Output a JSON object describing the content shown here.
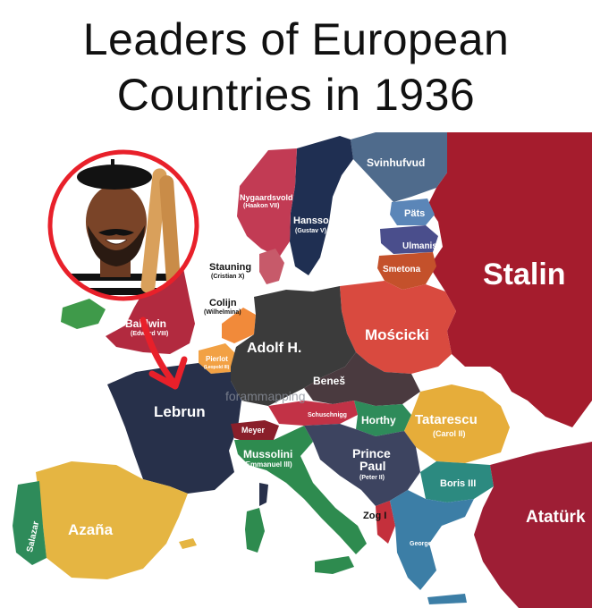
{
  "title": {
    "line1": "Leaders of European",
    "line2": "Countries in 1936"
  },
  "watermark": "forammapping",
  "colors": {
    "soviet": "#a51c2d",
    "germany": "#3b3b3b",
    "france": "#27304a",
    "spain": "#e5b542",
    "poland": "#d94a3f",
    "italy": "#2e8b4f",
    "romania": "#e6ad3a",
    "yugoslavia": "#3d4460",
    "turkey": "#9e1e35",
    "sea": "#ffffff"
  },
  "leaders": {
    "stalin": "Stalin",
    "svinhufvud": "Svinhufvud",
    "pats": "Päts",
    "ulmanis": "Ulmanis",
    "smetona": "Smetona",
    "moscicki": "Mościcki",
    "hansson": "Hansson",
    "hansson_sub": "(Gustav V)",
    "nygaardsvold": "Nygaardsvold",
    "nygaardsvold_sub": "(Haakon VII)",
    "stauning": "Stauning",
    "stauning_sub": "(Cristian X)",
    "colijn": "Colijn",
    "colijn_sub": "(Wilhelmina)",
    "baldwin": "Baldwin",
    "baldwin_sub": "(Edward VIII)",
    "pierlot": "Pierlot",
    "pierlot_sub": "(Leopold III)",
    "hitler": "Adolf H.",
    "benes": "Beneš",
    "lebrun": "Lebrun",
    "schuschnigg": "Schuschnigg",
    "horthy": "Horthy",
    "tatarescu": "Tatarescu",
    "tatarescu_sub": "(Carol II)",
    "meyer": "Meyer",
    "mussolini": "Mussolini",
    "mussolini_sub": "(Emmanuel III)",
    "prince_paul_1": "Prince",
    "prince_paul_2": "Paul",
    "prince_paul_sub": "(Peter II)",
    "boris": "Boris III",
    "zog": "Zog I",
    "salazar": "Salazar",
    "azana": "Azaña",
    "george": "George II",
    "ataturk": "Atatürk"
  }
}
